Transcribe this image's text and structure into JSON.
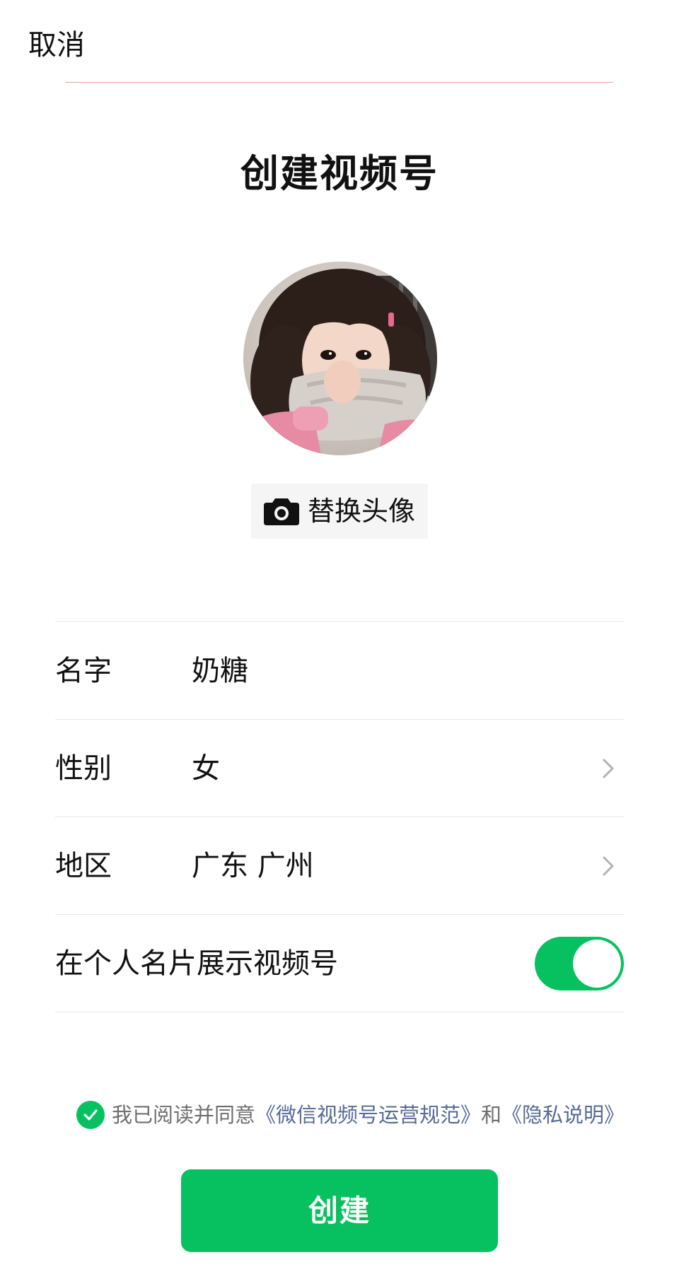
{
  "header": {
    "cancel_label": "取消"
  },
  "page": {
    "title": "创建视频号"
  },
  "avatar": {
    "replace_label": "替换头像",
    "camera_icon": "camera-icon"
  },
  "form": {
    "name": {
      "label": "名字",
      "value": "奶糖"
    },
    "gender": {
      "label": "性别",
      "value": "女"
    },
    "region": {
      "label": "地区",
      "value": "广东 广州"
    },
    "show_on_card": {
      "label": "在个人名片展示视频号",
      "enabled": true
    }
  },
  "agreement": {
    "checked": true,
    "prefix": "我已阅读并同意",
    "link1": "《微信视频号运营规范》",
    "middle": "和",
    "link2": "《隐私说明》"
  },
  "actions": {
    "create_label": "创建"
  },
  "colors": {
    "accent": "#07c160",
    "link": "#576b95",
    "muted_text": "#6f6f6f",
    "divider": "#e7e7e7"
  }
}
